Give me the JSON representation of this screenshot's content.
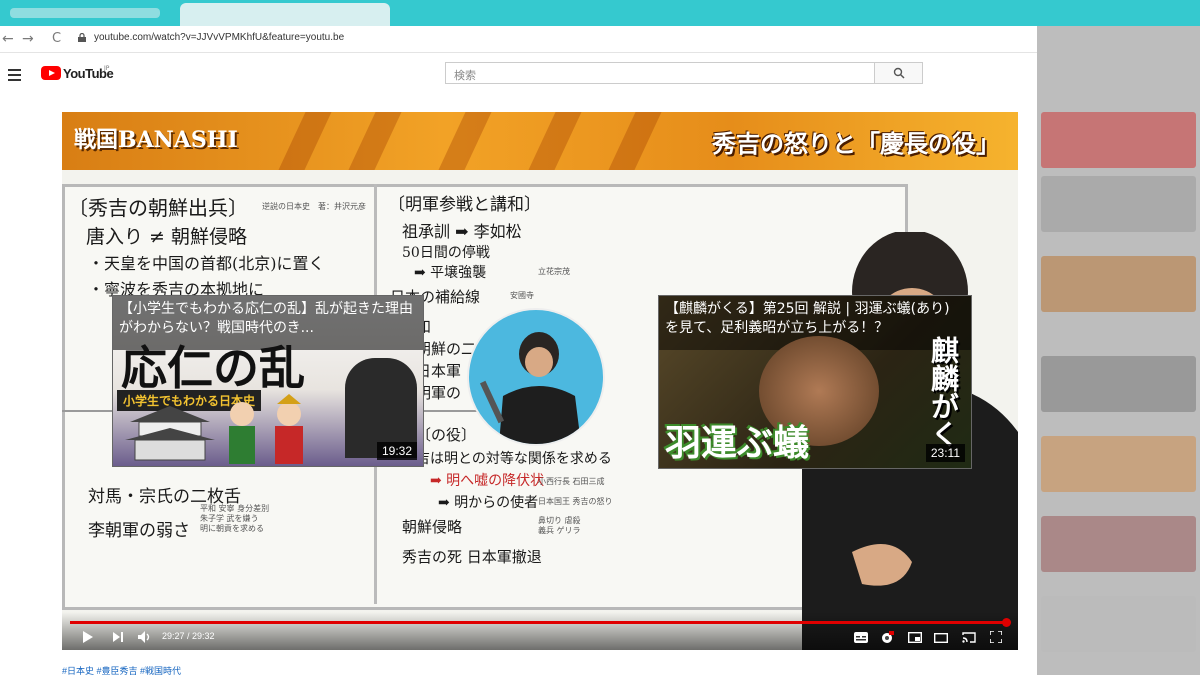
{
  "browser": {
    "url": "youtube.com/watch?v=JJVvVPMKhfU&feature=youtu.be",
    "back_icon": "←",
    "forward_icon": "→",
    "reload_icon": "C"
  },
  "header": {
    "logo_text": "YouTube",
    "region": "JP",
    "search_placeholder": "検索"
  },
  "video": {
    "channel_logo": "戦国BANASHI",
    "banner_title": "秀吉の怒りと「慶長の役」",
    "time_current": "29:27",
    "time_total": "29:32",
    "time_display": "29:27 / 29:32",
    "progress": 0.997
  },
  "board": {
    "left": {
      "heading": "〔秀吉の朝鮮出兵〕",
      "ref": "逆説の日本史　著：井沢元彦",
      "l1": "唐入り ≠ 朝鮮侵略",
      "l2": "・天皇を中国の首都(北京)に置く",
      "l3": "・寧波を秀吉の本拠地に",
      "l5": "対馬・宗氏の二枚舌",
      "l6": "李朝軍の弱さ",
      "bottom_notes": "平和 安寧 身分差別\n朱子学 武を嫌う\n明に朝貢を求める"
    },
    "right": {
      "heading": "〔明軍参戦と講和〕",
      "r1": "祖承訓 ➡ 李如松",
      "r2": "50日間の停戦",
      "r3": "➡ 平壌強襲",
      "r3_note": "立花宗茂",
      "r4": "日本の補給線",
      "r4_note": "安國寺",
      "r5": "和",
      "r6": "朝鮮の二",
      "r7": "日本軍",
      "r8": "明軍の",
      "r9": "〔の役〕",
      "r10": "吉は明との対等な関係を求める",
      "r11": "➡ 明へ嘘の降伏状",
      "r12": "➡ 明からの使者",
      "r13": "朝鮮侵略",
      "r14": "秀吉の死 日本軍撤退",
      "r14_note": "鼻切り 虐殺\n義兵 ゲリラ",
      "r12_note": "日本国王 秀吉の怒り",
      "r11_note": "小西行長 石田三成"
    }
  },
  "end_cards": [
    {
      "title": "【小学生でもわかる応仁の乱】乱が起きた理由がわからない？戦国時代のき...",
      "big_text": "応仁の乱",
      "sub_text": "小学生でもわかる日本史",
      "duration": "19:32"
    },
    {
      "title": "【麒麟がくる】第25回 解説 | 羽運ぶ蟻(あり) を見て、足利義昭が立ち上がる！？",
      "big_text": "羽運ぶ蟻",
      "side_text": "麒麟がく",
      "duration": "23:11"
    }
  ],
  "tags": "#日本史 #豊臣秀吉 #戦国時代"
}
